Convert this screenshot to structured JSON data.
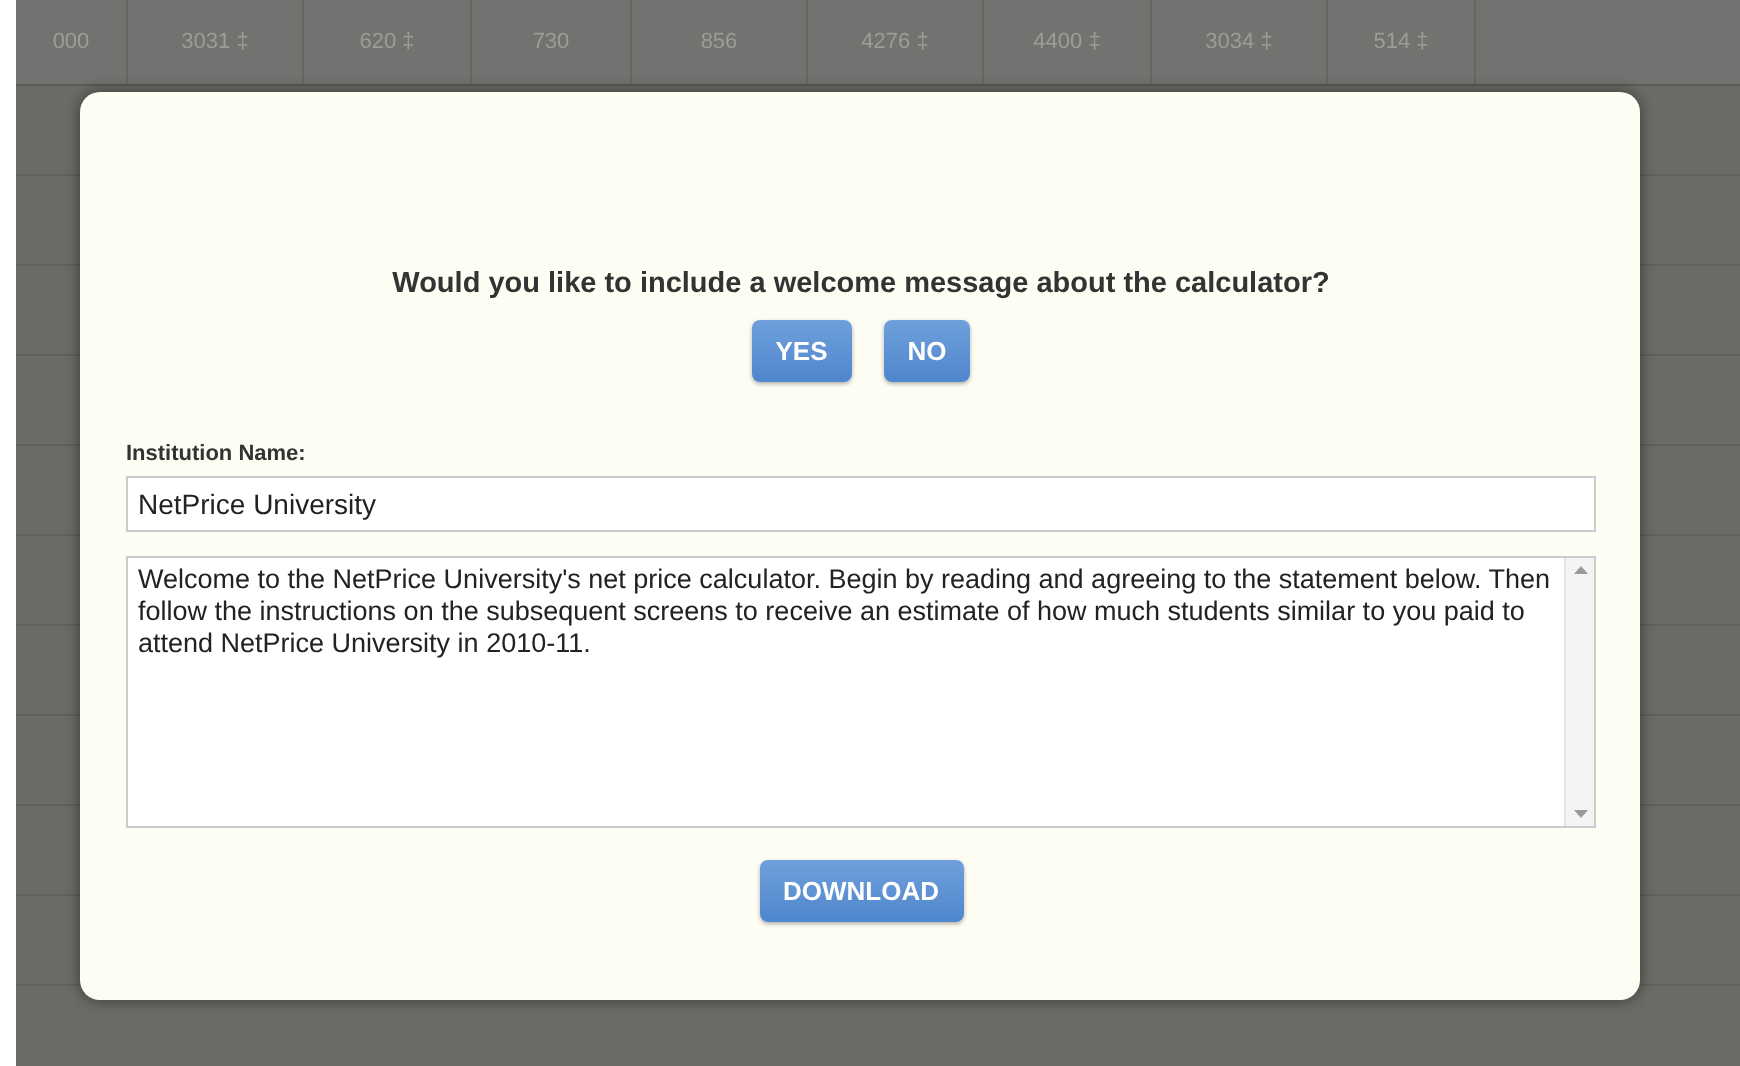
{
  "background_table": {
    "header_cells": [
      "000",
      "3031 ‡",
      "620 ‡",
      "730",
      "856",
      "4276 ‡",
      "4400 ‡",
      "3034 ‡",
      "514 ‡"
    ]
  },
  "dialog": {
    "question": "Would you like to include a welcome message about the calculator?",
    "choices": [
      {
        "label": "YES"
      },
      {
        "label": "NO"
      }
    ],
    "institution_label": "Institution Name:",
    "institution_value": "NetPrice University",
    "message": "Welcome to the NetPrice University's net price calculator. Begin by reading and agreeing to the statement below. Then follow the instructions on the subsequent screens to receive an estimate of how much students similar to you paid to attend NetPrice University in 2010-11.",
    "download_label": "DOWNLOAD"
  }
}
